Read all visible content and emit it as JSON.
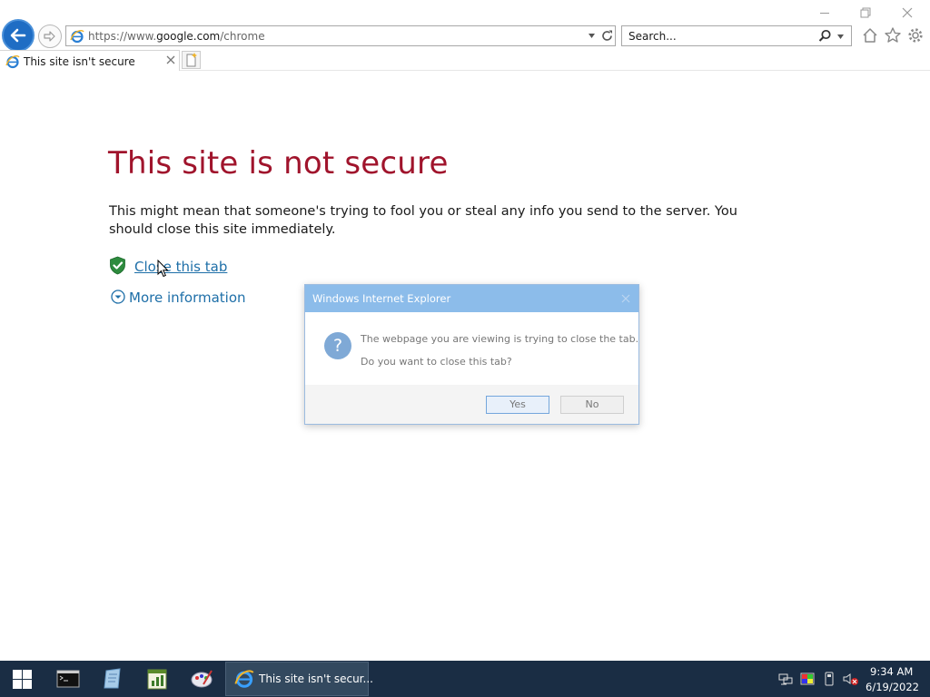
{
  "browser": {
    "address": {
      "scheme": "https://www.",
      "host": "google.com",
      "path": "/chrome"
    },
    "search_placeholder": "Search...",
    "tab": {
      "title": "This site isn't secure"
    }
  },
  "page": {
    "title": "This site is not secure",
    "description": "This might mean that someone's trying to fool you or steal any info you send to the server. You should close this site immediately.",
    "close_link": "Close this tab",
    "more_info_link": "More information"
  },
  "dialog": {
    "title": "Windows Internet Explorer",
    "message_line1": "The webpage you are viewing is trying to close the tab.",
    "message_line2": "Do you want to close this tab?",
    "yes_label": "Yes",
    "no_label": "No"
  },
  "taskbar": {
    "active_window_label": "This site isn't secur...",
    "clock_time": "9:34 AM",
    "clock_date": "6/19/2022"
  },
  "colors": {
    "title_red": "#a0142c",
    "link_blue": "#1e6fa8",
    "taskbar_bg": "#1a2d44",
    "dialog_title_bg": "#8cbcea"
  }
}
